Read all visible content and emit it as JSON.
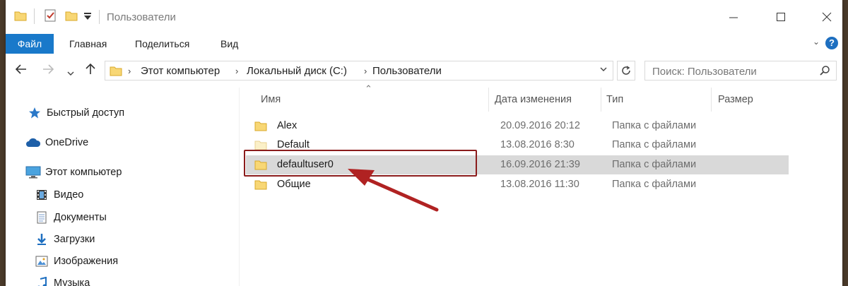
{
  "window": {
    "title": "Пользователи"
  },
  "ribbon": {
    "tabs": [
      {
        "label": "Файл"
      },
      {
        "label": "Главная"
      },
      {
        "label": "Поделиться"
      },
      {
        "label": "Вид"
      }
    ],
    "help": "?"
  },
  "address": {
    "crumbs": [
      "Этот компьютер",
      "Локальный диск (C:)",
      "Пользователи"
    ]
  },
  "search": {
    "placeholder": "Поиск: Пользователи"
  },
  "nav": {
    "items": [
      {
        "label": "Быстрый доступ",
        "icon": "star-icon"
      },
      {
        "label": "OneDrive",
        "icon": "cloud-icon"
      },
      {
        "label": "Этот компьютер",
        "icon": "computer-icon"
      },
      {
        "label": "Видео",
        "icon": "video-icon"
      },
      {
        "label": "Документы",
        "icon": "documents-icon"
      },
      {
        "label": "Загрузки",
        "icon": "downloads-icon"
      },
      {
        "label": "Изображения",
        "icon": "pictures-icon"
      },
      {
        "label": "Музыка",
        "icon": "music-icon"
      }
    ]
  },
  "columns": {
    "name": "Имя",
    "date": "Дата изменения",
    "type": "Тип",
    "size": "Размер"
  },
  "files": [
    {
      "name": "Alex",
      "date": "20.09.2016 20:12",
      "type": "Папка с файлами",
      "selected": false
    },
    {
      "name": "Default",
      "date": "13.08.2016 8:30",
      "type": "Папка с файлами",
      "selected": false
    },
    {
      "name": "defaultuser0",
      "date": "16.09.2016 21:39",
      "type": "Папка с файлами",
      "selected": true
    },
    {
      "name": "Общие",
      "date": "13.08.2016 11:30",
      "type": "Папка с файлами",
      "selected": false
    }
  ],
  "colors": {
    "accent": "#1979ca",
    "folder": "#f8d775",
    "annotation": "#8b1c1c",
    "selection": "#d9d9d9"
  }
}
